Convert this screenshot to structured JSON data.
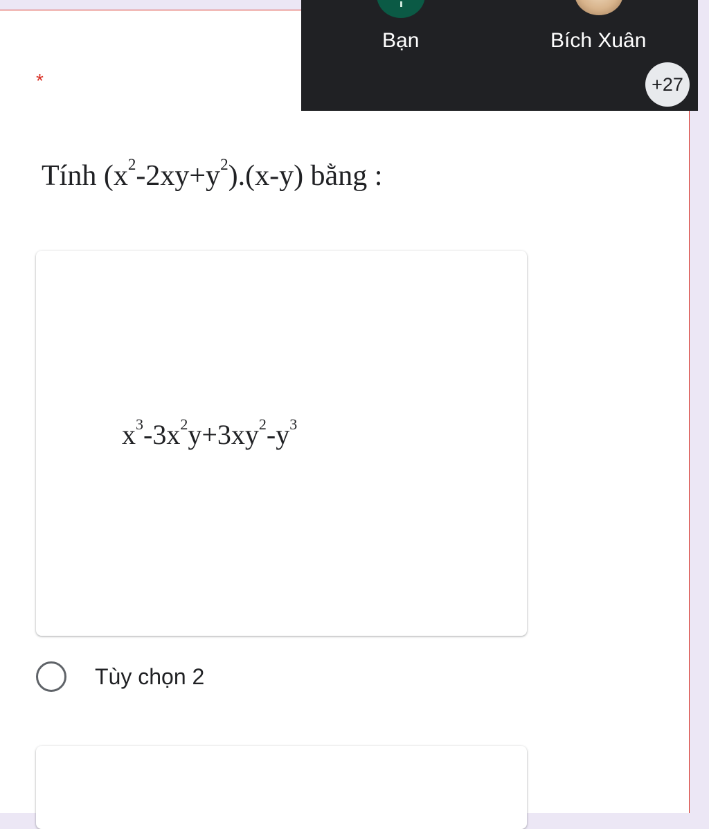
{
  "form": {
    "required_mark": "*",
    "question": {
      "prefix": "Tính",
      "parts": [
        "(x",
        "2",
        "-2xy+y",
        "2",
        ").(x-y) bằng :"
      ]
    },
    "option_1_formula": [
      "x",
      "3",
      "-3x",
      "2",
      "y+3xy",
      "2",
      "-y",
      "3"
    ],
    "option_2_label": "Tùy chọn 2"
  },
  "call_overlay": {
    "participants": [
      {
        "name": "Bạn",
        "avatar": "user-avatar-icon",
        "color": "#0b5a45"
      },
      {
        "name": "Bích Xuân",
        "avatar": "profile-photo"
      }
    ],
    "more_count": "+27"
  },
  "colors": {
    "required": "#d93025",
    "overlay_bg": "#202124",
    "page_bg": "#ece7f5"
  }
}
